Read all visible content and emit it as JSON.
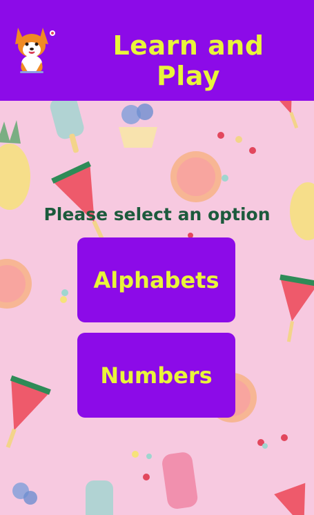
{
  "header": {
    "title": "Learn and Play",
    "logo_icon": "corgi-dog-icon",
    "bg_color": "#8c0be8",
    "title_color": "#e9f53a"
  },
  "main": {
    "prompt": "Please select an option",
    "options": [
      {
        "label": "Alphabets",
        "icon": ""
      },
      {
        "label": "Numbers",
        "icon": ""
      }
    ],
    "background_pattern": "fruit-popsicle-pattern",
    "background_color": "#f7c9e0"
  }
}
